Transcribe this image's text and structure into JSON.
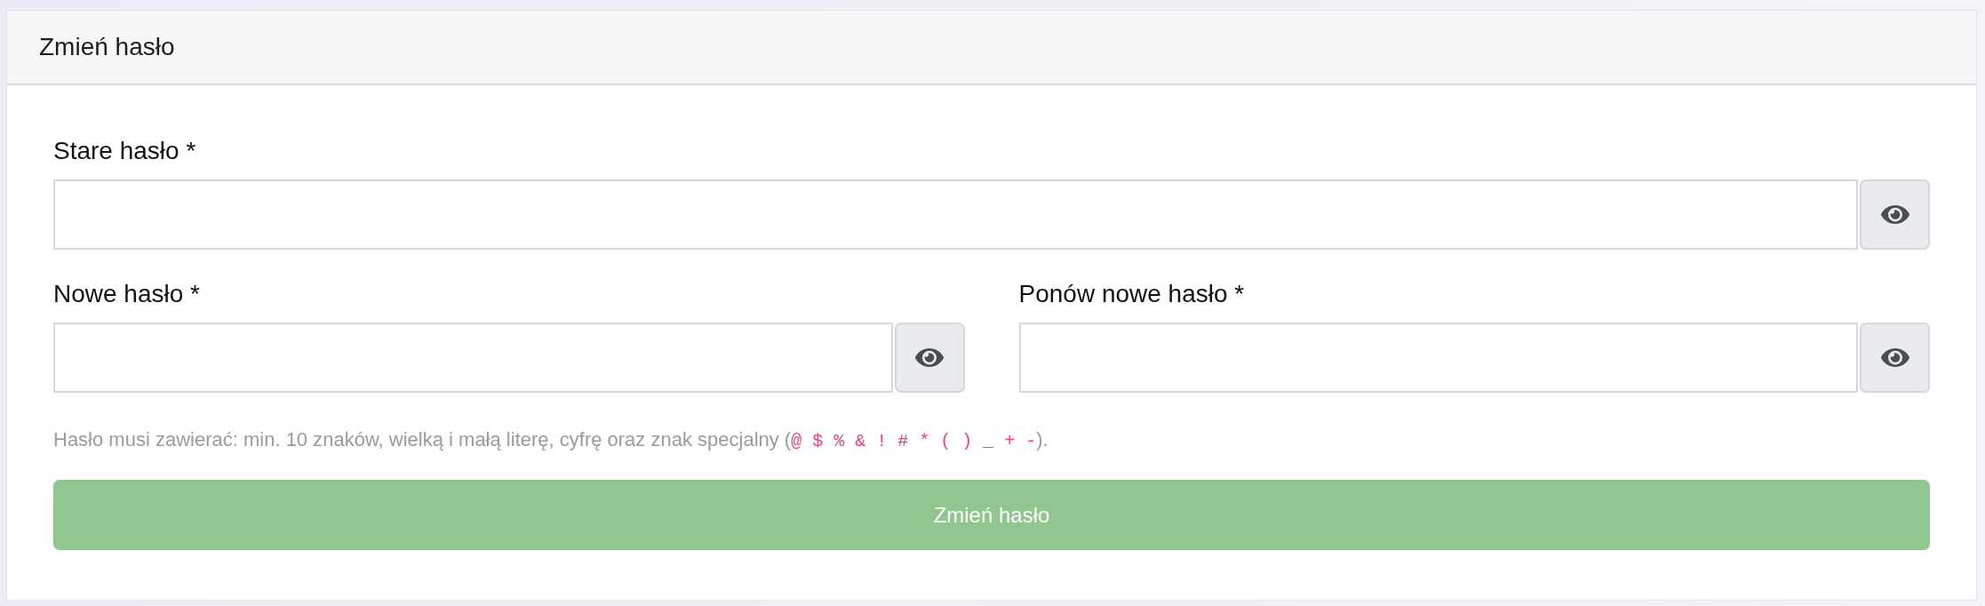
{
  "card": {
    "title": "Zmień hasło"
  },
  "form": {
    "rows": [
      {
        "fields": [
          {
            "label": "Stare hasło *"
          }
        ]
      },
      {
        "fields": [
          {
            "label": "Nowe hasło *"
          },
          {
            "label": "Ponów nowe hasło *"
          }
        ]
      }
    ]
  },
  "hint": {
    "text": "Hasło musi zawierać: min. 10 znaków, wielką i małą literę, cyfrę oraz znak specjalny (",
    "code": "@ $ % & ! # * ( ) _ + -",
    "end": ")."
  },
  "submit": {
    "label": "Zmień hasło",
    "disabled": true
  }
}
